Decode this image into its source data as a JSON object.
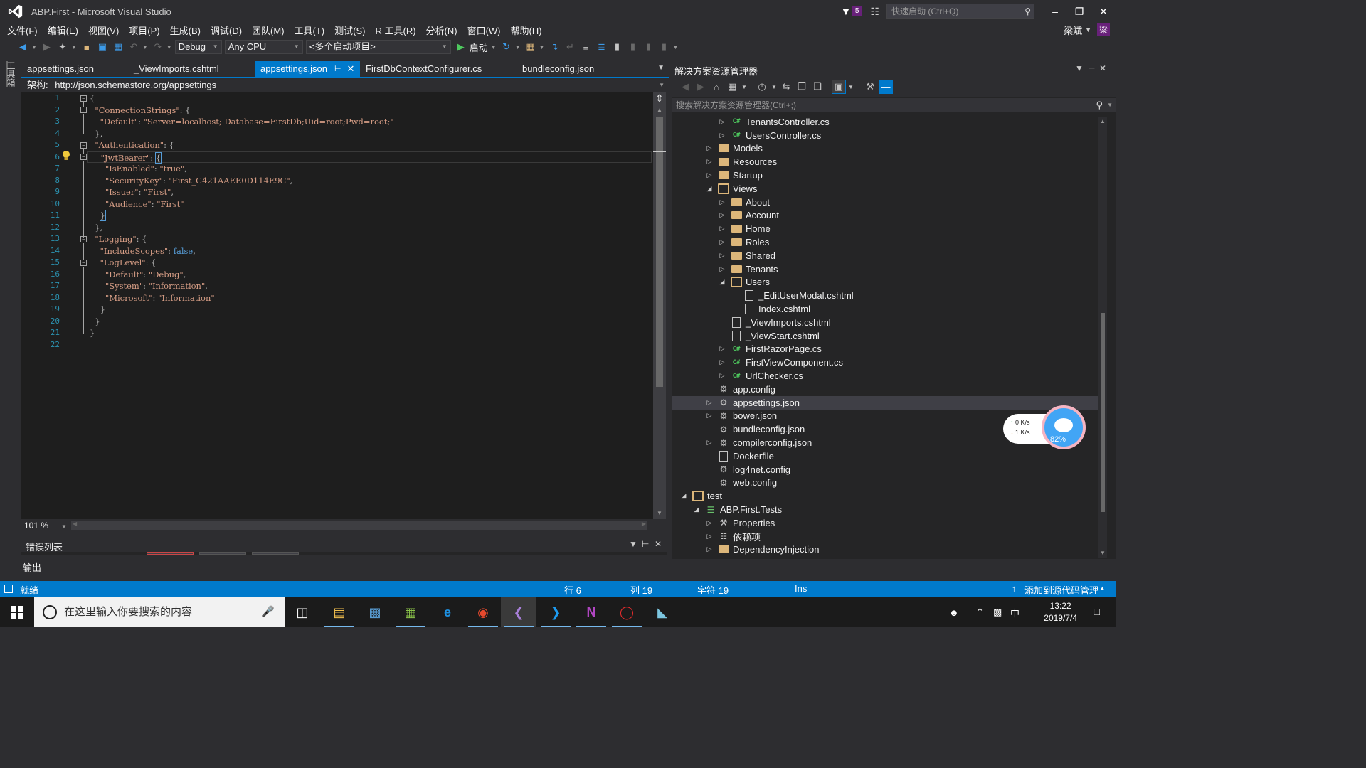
{
  "window": {
    "title": "ABP.First - Microsoft Visual Studio",
    "notification_count": "5",
    "quick_launch_placeholder": "快速启动 (Ctrl+Q)",
    "user_name": "梁斌",
    "user_initial": "梁"
  },
  "menu": [
    "文件(F)",
    "编辑(E)",
    "视图(V)",
    "项目(P)",
    "生成(B)",
    "调试(D)",
    "团队(M)",
    "工具(T)",
    "测试(S)",
    "R 工具(R)",
    "分析(N)",
    "窗口(W)",
    "帮助(H)"
  ],
  "toolbar": {
    "configuration": "Debug",
    "platform": "Any CPU",
    "startup": "<多个启动项目>",
    "start_label": "启动"
  },
  "toolbox_label": "工具箱",
  "editor_tabs": [
    {
      "label": "appsettings.json",
      "active": false
    },
    {
      "label": "_ViewImports.cshtml",
      "active": false
    },
    {
      "label": "appsettings.json",
      "active": true
    },
    {
      "label": "FirstDbContextConfigurer.cs",
      "active": false
    },
    {
      "label": "bundleconfig.json",
      "active": false
    }
  ],
  "schema": {
    "label": "架构:",
    "url": "http://json.schemastore.org/appsettings"
  },
  "code_lines": [
    "{",
    "  \"ConnectionStrings\": {",
    "    \"Default\": \"Server=localhost; Database=FirstDb;Uid=root;Pwd=root;\"",
    "  },",
    "  \"Authentication\": {",
    "    \"JwtBearer\": {",
    "      \"IsEnabled\": \"true\",",
    "      \"SecurityKey\": \"First_C421AAEE0D114E9C\",",
    "      \"Issuer\": \"First\",",
    "      \"Audience\": \"First\"",
    "    }",
    "  },",
    "  \"Logging\": {",
    "    \"IncludeScopes\": false,",
    "    \"LogLevel\": {",
    "      \"Default\": \"Debug\",",
    "      \"System\": \"Information\",",
    "      \"Microsoft\": \"Information\"",
    "    }",
    "  }",
    "}",
    ""
  ],
  "line_numbers": [
    "1",
    "2",
    "3",
    "4",
    "5",
    "6",
    "7",
    "8",
    "9",
    "10",
    "11",
    "12",
    "13",
    "14",
    "15",
    "16",
    "17",
    "18",
    "19",
    "20",
    "21",
    "22"
  ],
  "zoom": "101 %",
  "error_list_title": "错误列表",
  "output_title": "输出",
  "solution_explorer": {
    "title": "解决方案资源管理器",
    "search_placeholder": "搜索解决方案资源管理器(Ctrl+;)",
    "items": [
      {
        "label": "TenantsController.cs",
        "icon": "cs-file-icon",
        "level": 3,
        "expander": "collapsed"
      },
      {
        "label": "UsersController.cs",
        "icon": "cs-file-icon",
        "level": 3,
        "expander": "collapsed"
      },
      {
        "label": "Models",
        "icon": "folder-icon",
        "level": 2,
        "expander": "collapsed"
      },
      {
        "label": "Resources",
        "icon": "folder-icon",
        "level": 2,
        "expander": "collapsed"
      },
      {
        "label": "Startup",
        "icon": "folder-icon",
        "level": 2,
        "expander": "collapsed"
      },
      {
        "label": "Views",
        "icon": "folder-open-icon",
        "level": 2,
        "expander": "expanded"
      },
      {
        "label": "About",
        "icon": "folder-icon",
        "level": 3,
        "expander": "collapsed"
      },
      {
        "label": "Account",
        "icon": "folder-icon",
        "level": 3,
        "expander": "collapsed"
      },
      {
        "label": "Home",
        "icon": "folder-icon",
        "level": 3,
        "expander": "collapsed"
      },
      {
        "label": "Roles",
        "icon": "folder-icon",
        "level": 3,
        "expander": "collapsed"
      },
      {
        "label": "Shared",
        "icon": "folder-icon",
        "level": 3,
        "expander": "collapsed"
      },
      {
        "label": "Tenants",
        "icon": "folder-icon",
        "level": 3,
        "expander": "collapsed"
      },
      {
        "label": "Users",
        "icon": "folder-open-icon",
        "level": 3,
        "expander": "expanded"
      },
      {
        "label": "_EditUserModal.cshtml",
        "icon": "file-icon",
        "level": 4,
        "expander": "none"
      },
      {
        "label": "Index.cshtml",
        "icon": "file-icon",
        "level": 4,
        "expander": "none"
      },
      {
        "label": "_ViewImports.cshtml",
        "icon": "file-icon",
        "level": 3,
        "expander": "none"
      },
      {
        "label": "_ViewStart.cshtml",
        "icon": "file-icon",
        "level": 3,
        "expander": "none"
      },
      {
        "label": "FirstRazorPage.cs",
        "icon": "cs-file-icon",
        "level": 3,
        "expander": "collapsed"
      },
      {
        "label": "FirstViewComponent.cs",
        "icon": "cs-file-icon",
        "level": 3,
        "expander": "collapsed"
      },
      {
        "label": "UrlChecker.cs",
        "icon": "cs-file-icon",
        "level": 3,
        "expander": "collapsed"
      },
      {
        "label": "app.config",
        "icon": "config-file-icon",
        "level": 2,
        "expander": "none"
      },
      {
        "label": "appsettings.json",
        "icon": "config-file-icon",
        "level": 2,
        "expander": "collapsed",
        "selected": true
      },
      {
        "label": "bower.json",
        "icon": "config-file-icon",
        "level": 2,
        "expander": "collapsed"
      },
      {
        "label": "bundleconfig.json",
        "icon": "config-file-icon",
        "level": 2,
        "expander": "none"
      },
      {
        "label": "compilerconfig.json",
        "icon": "config-file-icon",
        "level": 2,
        "expander": "collapsed"
      },
      {
        "label": "Dockerfile",
        "icon": "file-icon",
        "level": 2,
        "expander": "none"
      },
      {
        "label": "log4net.config",
        "icon": "config-file-icon",
        "level": 2,
        "expander": "none"
      },
      {
        "label": "web.config",
        "icon": "config-file-icon",
        "level": 2,
        "expander": "none"
      },
      {
        "label": "test",
        "icon": "folder-open-icon",
        "level": 0,
        "expander": "expanded"
      },
      {
        "label": "ABP.First.Tests",
        "icon": "project-icon",
        "level": 1,
        "expander": "expanded"
      },
      {
        "label": "Properties",
        "icon": "wrench-icon",
        "level": 2,
        "expander": "collapsed"
      },
      {
        "label": "依赖项",
        "icon": "dependencies-icon",
        "level": 2,
        "expander": "collapsed"
      },
      {
        "label": "DependencyInjection",
        "icon": "folder-icon",
        "level": 2,
        "expander": "collapsed"
      }
    ]
  },
  "net_widget": {
    "up": "0  K/s",
    "down": "1  K/s",
    "percent": "82%"
  },
  "status": {
    "ready": "就绪",
    "line": "行 6",
    "col": "列 19",
    "char": "字符 19",
    "mode": "Ins",
    "source_control": "添加到源代码管理"
  },
  "taskbar": {
    "search_placeholder": "在这里输入你要搜索的内容",
    "time": "13:22",
    "date": "2019/7/4",
    "ime": "中"
  },
  "colors": {
    "accent": "#007acc",
    "editor_bg": "#1e1e1e",
    "string": "#d69d85",
    "keyword": "#569cd6",
    "line_number": "#2b91af"
  }
}
